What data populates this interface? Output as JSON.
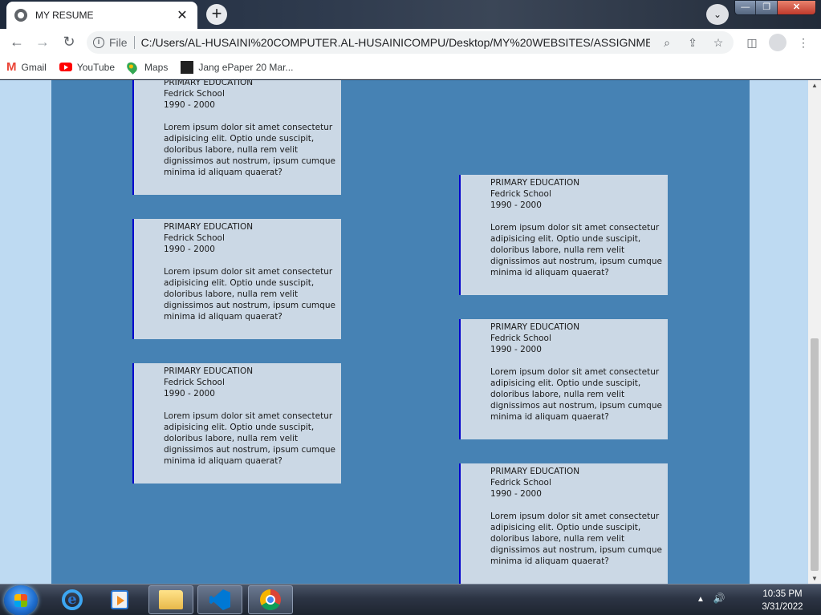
{
  "browser": {
    "tab_title": "MY RESUME",
    "tab_close": "✕",
    "new_tab": "+",
    "tab_search": "⌄",
    "window_controls": {
      "minimize": "—",
      "maximize": "❐",
      "close": "✕"
    },
    "nav": {
      "back": "←",
      "forward": "→",
      "reload": "↻"
    },
    "address": {
      "info": "i",
      "file_label": "File",
      "url": "C:/Users/AL-HUSAINI%20COMPUTER.AL-HUSAINICOMPU/Desktop/MY%20WEBSITES/ASSIGNMENT...",
      "zoom_icon": "⌕",
      "share_icon": "⇪",
      "bookmark_icon": "☆"
    },
    "side_panel_icon": "◫",
    "menu_icon": "⋮",
    "bookmarks": [
      {
        "icon": "gmail-icon",
        "label": "Gmail"
      },
      {
        "icon": "youtube-icon",
        "label": "YouTube"
      },
      {
        "icon": "maps-icon",
        "label": "Maps"
      },
      {
        "icon": "jang-icon",
        "label": "Jang ePaper 20 Mar..."
      }
    ]
  },
  "page": {
    "left_cards": [
      {
        "title": "PRIMARY EDUCATION",
        "school": "Fedrick School",
        "years": "1990 - 2000",
        "desc": "Lorem ipsum dolor sit amet consectetur adipisicing elit. Optio unde suscipit, doloribus labore, nulla rem velit dignissimos aut nostrum, ipsum cumque minima id aliquam quaerat?"
      },
      {
        "title": "PRIMARY EDUCATION",
        "school": "Fedrick School",
        "years": "1990 - 2000",
        "desc": "Lorem ipsum dolor sit amet consectetur adipisicing elit. Optio unde suscipit, doloribus labore, nulla rem velit dignissimos aut nostrum, ipsum cumque minima id aliquam quaerat?"
      },
      {
        "title": "PRIMARY EDUCATION",
        "school": "Fedrick School",
        "years": "1990 - 2000",
        "desc": "Lorem ipsum dolor sit amet consectetur adipisicing elit. Optio unde suscipit, doloribus labore, nulla rem velit dignissimos aut nostrum, ipsum cumque minima id aliquam quaerat?"
      }
    ],
    "right_cards": [
      {
        "title": "PRIMARY EDUCATION",
        "school": "Fedrick School",
        "years": "1990 - 2000",
        "desc": "Lorem ipsum dolor sit amet consectetur adipisicing elit. Optio unde suscipit, doloribus labore, nulla rem velit dignissimos aut nostrum, ipsum cumque minima id aliquam quaerat?"
      },
      {
        "title": "PRIMARY EDUCATION",
        "school": "Fedrick School",
        "years": "1990 - 2000",
        "desc": "Lorem ipsum dolor sit amet consectetur adipisicing elit. Optio unde suscipit, doloribus labore, nulla rem velit dignissimos aut nostrum, ipsum cumque minima id aliquam quaerat?"
      },
      {
        "title": "PRIMARY EDUCATION",
        "school": "Fedrick School",
        "years": "1990 - 2000",
        "desc": "Lorem ipsum dolor sit amet consectetur adipisicing elit. Optio unde suscipit, doloribus labore, nulla rem velit dignissimos aut nostrum, ipsum cumque minima id aliquam quaerat?"
      }
    ]
  },
  "scrollbar": {
    "up": "▲",
    "down": "▼"
  },
  "taskbar": {
    "apps": [
      "internet-explorer-icon",
      "media-player-icon",
      "file-explorer-icon",
      "vscode-icon",
      "chrome-icon"
    ],
    "tray": {
      "arrow": "▲",
      "volume": "🔊"
    },
    "time": "10:35 PM",
    "date": "3/31/2022"
  },
  "colors": {
    "page_background": "#bedaf2",
    "content_background": "#4682b4",
    "card_background": "#cbd8e5",
    "card_border": "#0000cd"
  }
}
